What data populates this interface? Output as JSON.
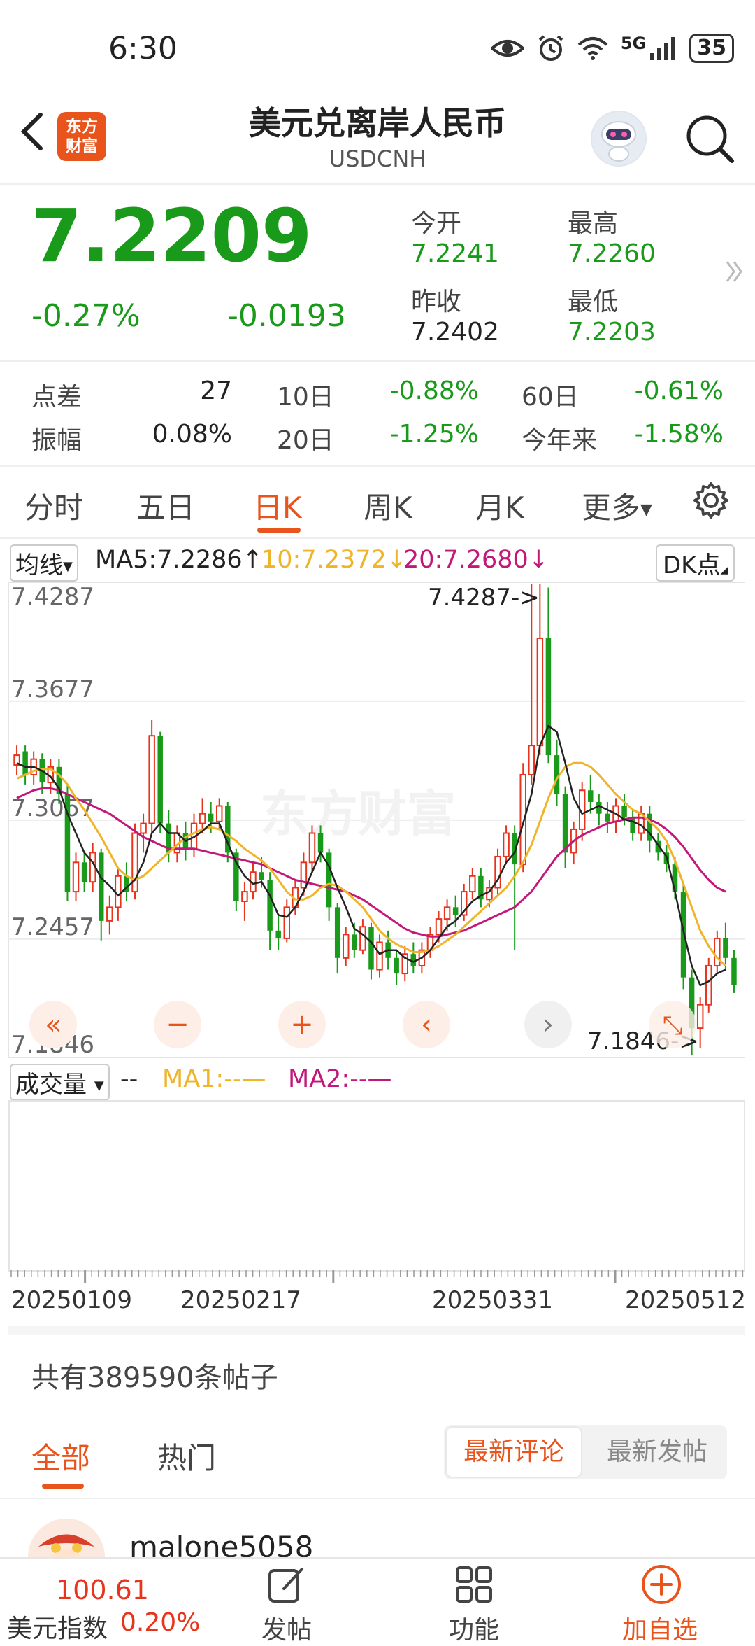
{
  "status": {
    "time": "6:30",
    "network": "5G",
    "battery": "35"
  },
  "header": {
    "title": "美元兑离岸人民币",
    "subtitle": "USDCNH",
    "logo_line1": "东方",
    "logo_line2": "财富"
  },
  "quote": {
    "price": "7.2209",
    "pct": "-0.27%",
    "chg": "-0.0193",
    "open_label": "今开",
    "open": "7.2241",
    "high_label": "最高",
    "high": "7.2260",
    "prev_label": "昨收",
    "prev": "7.2402",
    "low_label": "最低",
    "low": "7.2203"
  },
  "stats": [
    {
      "label": "点差",
      "value": "27"
    },
    {
      "label": "振幅",
      "value": "0.08%"
    },
    {
      "label": "10日",
      "value": "-0.88%"
    },
    {
      "label": "20日",
      "value": "-1.25%"
    },
    {
      "label": "60日",
      "value": "-0.61%"
    },
    {
      "label": "今年来",
      "value": "-1.58%"
    }
  ],
  "tabs": [
    "分时",
    "五日",
    "日K",
    "周K",
    "月K",
    "更多"
  ],
  "ma": {
    "select": "均线",
    "ma5": "MA5:7.2286↑",
    "ma10": "10:7.2372↓",
    "ma20": "20:7.2680↓",
    "dk": "DK点"
  },
  "colors": {
    "up": "#e8341c",
    "down": "#1a9a1a",
    "accent": "#e8541c",
    "ma5": "#222222",
    "ma10": "#f0b429",
    "ma20": "#c2187a"
  },
  "chart_data": {
    "type": "candlestick",
    "y_axis_labels": [
      "7.4287",
      "7.3677",
      "7.3067",
      "7.2457",
      "7.1846"
    ],
    "ylim": [
      7.1846,
      7.4287
    ],
    "max_marker": "7.4287->",
    "min_marker": "7.1846->",
    "x_labels": [
      "20250109",
      "20250217",
      "20250331",
      "20250512"
    ],
    "watermark": "东方财富",
    "grid": true,
    "candles": [
      {
        "o": 7.335,
        "c": 7.34,
        "h": 7.345,
        "l": 7.33
      },
      {
        "o": 7.342,
        "c": 7.33,
        "h": 7.345,
        "l": 7.325
      },
      {
        "o": 7.33,
        "c": 7.338,
        "h": 7.342,
        "l": 7.325
      },
      {
        "o": 7.338,
        "c": 7.326,
        "h": 7.341,
        "l": 7.32
      },
      {
        "o": 7.326,
        "c": 7.334,
        "h": 7.338,
        "l": 7.32
      },
      {
        "o": 7.334,
        "c": 7.32,
        "h": 7.338,
        "l": 7.315
      },
      {
        "o": 7.32,
        "c": 7.27,
        "h": 7.325,
        "l": 7.265
      },
      {
        "o": 7.27,
        "c": 7.285,
        "h": 7.29,
        "l": 7.265
      },
      {
        "o": 7.285,
        "c": 7.275,
        "h": 7.29,
        "l": 7.27
      },
      {
        "o": 7.275,
        "c": 7.29,
        "h": 7.295,
        "l": 7.27
      },
      {
        "o": 7.29,
        "c": 7.255,
        "h": 7.292,
        "l": 7.245
      },
      {
        "o": 7.255,
        "c": 7.262,
        "h": 7.268,
        "l": 7.248
      },
      {
        "o": 7.262,
        "c": 7.278,
        "h": 7.282,
        "l": 7.255
      },
      {
        "o": 7.278,
        "c": 7.27,
        "h": 7.285,
        "l": 7.265
      },
      {
        "o": 7.27,
        "c": 7.3,
        "h": 7.305,
        "l": 7.266
      },
      {
        "o": 7.3,
        "c": 7.305,
        "h": 7.31,
        "l": 7.29
      },
      {
        "o": 7.305,
        "c": 7.35,
        "h": 7.358,
        "l": 7.3
      },
      {
        "o": 7.35,
        "c": 7.305,
        "h": 7.352,
        "l": 7.3
      },
      {
        "o": 7.305,
        "c": 7.29,
        "h": 7.312,
        "l": 7.285
      },
      {
        "o": 7.29,
        "c": 7.3,
        "h": 7.304,
        "l": 7.285
      },
      {
        "o": 7.3,
        "c": 7.292,
        "h": 7.306,
        "l": 7.286
      },
      {
        "o": 7.292,
        "c": 7.305,
        "h": 7.31,
        "l": 7.288
      },
      {
        "o": 7.305,
        "c": 7.31,
        "h": 7.318,
        "l": 7.3
      },
      {
        "o": 7.31,
        "c": 7.306,
        "h": 7.316,
        "l": 7.3
      },
      {
        "o": 7.306,
        "c": 7.314,
        "h": 7.318,
        "l": 7.302
      },
      {
        "o": 7.314,
        "c": 7.29,
        "h": 7.316,
        "l": 7.285
      },
      {
        "o": 7.29,
        "c": 7.265,
        "h": 7.292,
        "l": 7.26
      },
      {
        "o": 7.265,
        "c": 7.27,
        "h": 7.275,
        "l": 7.255
      },
      {
        "o": 7.27,
        "c": 7.28,
        "h": 7.285,
        "l": 7.266
      },
      {
        "o": 7.28,
        "c": 7.276,
        "h": 7.288,
        "l": 7.272
      },
      {
        "o": 7.276,
        "c": 7.25,
        "h": 7.28,
        "l": 7.24
      },
      {
        "o": 7.25,
        "c": 7.246,
        "h": 7.258,
        "l": 7.24
      },
      {
        "o": 7.246,
        "c": 7.262,
        "h": 7.266,
        "l": 7.244
      },
      {
        "o": 7.262,
        "c": 7.272,
        "h": 7.276,
        "l": 7.258
      },
      {
        "o": 7.272,
        "c": 7.285,
        "h": 7.29,
        "l": 7.268
      },
      {
        "o": 7.285,
        "c": 7.3,
        "h": 7.304,
        "l": 7.28
      },
      {
        "o": 7.3,
        "c": 7.29,
        "h": 7.304,
        "l": 7.285
      },
      {
        "o": 7.29,
        "c": 7.262,
        "h": 7.292,
        "l": 7.255
      },
      {
        "o": 7.262,
        "c": 7.236,
        "h": 7.264,
        "l": 7.228
      },
      {
        "o": 7.236,
        "c": 7.248,
        "h": 7.252,
        "l": 7.232
      },
      {
        "o": 7.248,
        "c": 7.24,
        "h": 7.254,
        "l": 7.236
      },
      {
        "o": 7.24,
        "c": 7.252,
        "h": 7.256,
        "l": 7.238
      },
      {
        "o": 7.252,
        "c": 7.23,
        "h": 7.254,
        "l": 7.225
      },
      {
        "o": 7.23,
        "c": 7.244,
        "h": 7.248,
        "l": 7.226
      },
      {
        "o": 7.244,
        "c": 7.236,
        "h": 7.25,
        "l": 7.23
      },
      {
        "o": 7.236,
        "c": 7.228,
        "h": 7.24,
        "l": 7.222
      },
      {
        "o": 7.228,
        "c": 7.238,
        "h": 7.242,
        "l": 7.224
      },
      {
        "o": 7.238,
        "c": 7.232,
        "h": 7.244,
        "l": 7.228
      },
      {
        "o": 7.232,
        "c": 7.24,
        "h": 7.244,
        "l": 7.228
      },
      {
        "o": 7.24,
        "c": 7.248,
        "h": 7.252,
        "l": 7.236
      },
      {
        "o": 7.248,
        "c": 7.256,
        "h": 7.26,
        "l": 7.244
      },
      {
        "o": 7.256,
        "c": 7.262,
        "h": 7.266,
        "l": 7.25
      },
      {
        "o": 7.262,
        "c": 7.258,
        "h": 7.268,
        "l": 7.252
      },
      {
        "o": 7.258,
        "c": 7.27,
        "h": 7.274,
        "l": 7.255
      },
      {
        "o": 7.27,
        "c": 7.278,
        "h": 7.282,
        "l": 7.266
      },
      {
        "o": 7.278,
        "c": 7.266,
        "h": 7.282,
        "l": 7.262
      },
      {
        "o": 7.266,
        "c": 7.272,
        "h": 7.276,
        "l": 7.262
      },
      {
        "o": 7.272,
        "c": 7.288,
        "h": 7.292,
        "l": 7.268
      },
      {
        "o": 7.288,
        "c": 7.3,
        "h": 7.304,
        "l": 7.284
      },
      {
        "o": 7.3,
        "c": 7.284,
        "h": 7.304,
        "l": 7.24
      },
      {
        "o": 7.284,
        "c": 7.33,
        "h": 7.336,
        "l": 7.28
      },
      {
        "o": 7.33,
        "c": 7.345,
        "h": 7.428,
        "l": 7.325
      },
      {
        "o": 7.345,
        "c": 7.4,
        "h": 7.428,
        "l": 7.34
      },
      {
        "o": 7.4,
        "c": 7.34,
        "h": 7.426,
        "l": 7.336
      },
      {
        "o": 7.34,
        "c": 7.32,
        "h": 7.348,
        "l": 7.314
      },
      {
        "o": 7.32,
        "c": 7.29,
        "h": 7.324,
        "l": 7.282
      },
      {
        "o": 7.29,
        "c": 7.302,
        "h": 7.306,
        "l": 7.284
      },
      {
        "o": 7.302,
        "c": 7.322,
        "h": 7.326,
        "l": 7.296
      },
      {
        "o": 7.322,
        "c": 7.316,
        "h": 7.33,
        "l": 7.31
      },
      {
        "o": 7.316,
        "c": 7.31,
        "h": 7.32,
        "l": 7.304
      },
      {
        "o": 7.31,
        "c": 7.306,
        "h": 7.316,
        "l": 7.3
      },
      {
        "o": 7.306,
        "c": 7.314,
        "h": 7.318,
        "l": 7.3
      },
      {
        "o": 7.314,
        "c": 7.308,
        "h": 7.32,
        "l": 7.304
      },
      {
        "o": 7.308,
        "c": 7.3,
        "h": 7.312,
        "l": 7.296
      },
      {
        "o": 7.3,
        "c": 7.31,
        "h": 7.314,
        "l": 7.296
      },
      {
        "o": 7.31,
        "c": 7.296,
        "h": 7.314,
        "l": 7.29
      },
      {
        "o": 7.296,
        "c": 7.29,
        "h": 7.3,
        "l": 7.286
      },
      {
        "o": 7.29,
        "c": 7.284,
        "h": 7.294,
        "l": 7.28
      },
      {
        "o": 7.284,
        "c": 7.27,
        "h": 7.288,
        "l": 7.266
      },
      {
        "o": 7.27,
        "c": 7.226,
        "h": 7.274,
        "l": 7.22
      },
      {
        "o": 7.226,
        "c": 7.2,
        "h": 7.23,
        "l": 7.186
      },
      {
        "o": 7.2,
        "c": 7.212,
        "h": 7.216,
        "l": 7.19
      },
      {
        "o": 7.212,
        "c": 7.232,
        "h": 7.236,
        "l": 7.208
      },
      {
        "o": 7.232,
        "c": 7.246,
        "h": 7.25,
        "l": 7.228
      },
      {
        "o": 7.246,
        "c": 7.236,
        "h": 7.254,
        "l": 7.23
      },
      {
        "o": 7.236,
        "c": 7.222,
        "h": 7.24,
        "l": 7.218
      }
    ],
    "ma5": [
      7.336,
      7.334,
      7.334,
      7.332,
      7.329,
      7.323,
      7.31,
      7.3,
      7.29,
      7.285,
      7.277,
      7.273,
      7.268,
      7.272,
      7.276,
      7.285,
      7.3,
      7.305,
      7.3,
      7.3,
      7.296,
      7.298,
      7.301,
      7.305,
      7.305,
      7.295,
      7.285,
      7.278,
      7.274,
      7.275,
      7.268,
      7.258,
      7.257,
      7.262,
      7.27,
      7.28,
      7.29,
      7.283,
      7.272,
      7.262,
      7.251,
      7.248,
      7.244,
      7.238,
      7.24,
      7.24,
      7.236,
      7.234,
      7.236,
      7.24,
      7.246,
      7.252,
      7.255,
      7.26,
      7.265,
      7.268,
      7.27,
      7.276,
      7.285,
      7.29,
      7.305,
      7.32,
      7.345,
      7.355,
      7.352,
      7.336,
      7.318,
      7.31,
      7.312,
      7.314,
      7.312,
      7.31,
      7.307,
      7.306,
      7.304,
      7.3,
      7.294,
      7.288,
      7.27,
      7.25,
      7.232,
      7.222,
      7.224,
      7.228,
      7.23
    ],
    "ma10": [
      7.328,
      7.33,
      7.332,
      7.333,
      7.333,
      7.33,
      7.325,
      7.318,
      7.312,
      7.305,
      7.298,
      7.29,
      7.282,
      7.278,
      7.276,
      7.278,
      7.282,
      7.286,
      7.29,
      7.294,
      7.298,
      7.3,
      7.302,
      7.303,
      7.302,
      7.299,
      7.296,
      7.292,
      7.289,
      7.286,
      7.282,
      7.276,
      7.27,
      7.266,
      7.266,
      7.268,
      7.272,
      7.274,
      7.273,
      7.27,
      7.266,
      7.262,
      7.256,
      7.25,
      7.246,
      7.243,
      7.241,
      7.239,
      7.239,
      7.24,
      7.242,
      7.245,
      7.248,
      7.252,
      7.256,
      7.26,
      7.264,
      7.268,
      7.272,
      7.278,
      7.285,
      7.294,
      7.306,
      7.318,
      7.328,
      7.334,
      7.336,
      7.336,
      7.334,
      7.33,
      7.325,
      7.32,
      7.316,
      7.312,
      7.31,
      7.306,
      7.302,
      7.296,
      7.286,
      7.274,
      7.262,
      7.25,
      7.242,
      7.236,
      7.232
    ],
    "ma20": [
      7.318,
      7.32,
      7.322,
      7.323,
      7.323,
      7.322,
      7.32,
      7.318,
      7.316,
      7.314,
      7.312,
      7.31,
      7.307,
      7.304,
      7.301,
      7.298,
      7.296,
      7.294,
      7.292,
      7.292,
      7.292,
      7.292,
      7.291,
      7.29,
      7.289,
      7.288,
      7.287,
      7.286,
      7.285,
      7.284,
      7.282,
      7.28,
      7.278,
      7.276,
      7.275,
      7.274,
      7.273,
      7.272,
      7.271,
      7.27,
      7.268,
      7.266,
      7.263,
      7.26,
      7.257,
      7.254,
      7.251,
      7.249,
      7.248,
      7.247,
      7.247,
      7.248,
      7.249,
      7.25,
      7.252,
      7.254,
      7.256,
      7.258,
      7.26,
      7.262,
      7.266,
      7.27,
      7.276,
      7.282,
      7.288,
      7.292,
      7.296,
      7.299,
      7.301,
      7.303,
      7.305,
      7.306,
      7.307,
      7.308,
      7.308,
      7.307,
      7.305,
      7.302,
      7.298,
      7.293,
      7.287,
      7.281,
      7.276,
      7.272,
      7.27
    ]
  },
  "chart_controls": [
    "«",
    "−",
    "+",
    "‹",
    "›",
    "⤡"
  ],
  "volume": {
    "select": "成交量",
    "dashes": "--",
    "ma1": "MA1:--—",
    "ma2": "MA2:--—"
  },
  "posts": {
    "count": "共有389590条帖子",
    "tab_all": "全部",
    "tab_hot": "热门",
    "sort_comment": "最新评论",
    "sort_post": "最新发帖",
    "username": "malone5058"
  },
  "bottom": {
    "idx_value": "100.61",
    "idx_name": "美元指数",
    "idx_chg": "0.20%",
    "post_label": "发帖",
    "func_label": "功能",
    "add_label": "加自选"
  }
}
